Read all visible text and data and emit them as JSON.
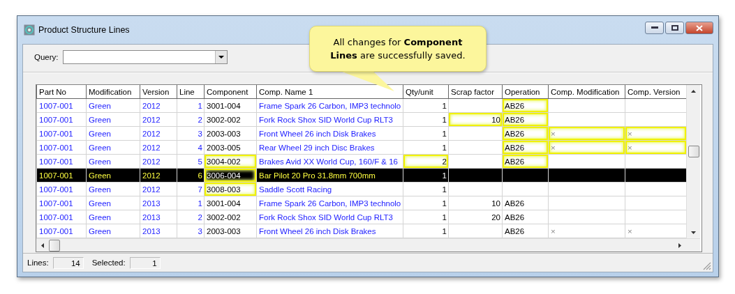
{
  "window": {
    "title": "Product Structure Lines"
  },
  "query": {
    "label": "Query:"
  },
  "callout": {
    "text": "All changes for **Component Lines** are successfully saved."
  },
  "table": {
    "columns": [
      "Part No",
      "Modification",
      "Version",
      "Line",
      "Component",
      "Comp. Name 1",
      "Qty/unit",
      "Scrap factor",
      "Operation",
      "Comp. Modification",
      "Comp. Version"
    ],
    "rows": [
      {
        "selected": false,
        "cells": [
          "1007-001",
          "Green",
          "2012",
          "1",
          "3001-004",
          "Frame Spark 26 Carbon, IMP3 technolo",
          "1",
          null,
          "AB26",
          null,
          null
        ],
        "highlighted": [
          false,
          false,
          false,
          false,
          false,
          false,
          false,
          false,
          true,
          false,
          false
        ]
      },
      {
        "selected": false,
        "cells": [
          "1007-001",
          "Green",
          "2012",
          "2",
          "3002-002",
          "Fork Rock Shox SID World Cup RLT3",
          "1",
          "10",
          "AB26",
          null,
          null
        ],
        "highlighted": [
          false,
          false,
          false,
          false,
          false,
          false,
          false,
          true,
          true,
          false,
          false
        ]
      },
      {
        "selected": false,
        "cells": [
          "1007-001",
          "Green",
          "2012",
          "3",
          "2003-003",
          "Front Wheel 26 inch Disk Brakes",
          "1",
          null,
          "AB26",
          "×",
          "×"
        ],
        "highlighted": [
          false,
          false,
          false,
          false,
          false,
          false,
          false,
          false,
          true,
          true,
          true
        ]
      },
      {
        "selected": false,
        "cells": [
          "1007-001",
          "Green",
          "2012",
          "4",
          "2003-005",
          "Rear Wheel 29 inch Disc Brakes",
          "1",
          null,
          "AB26",
          "×",
          "×"
        ],
        "highlighted": [
          false,
          false,
          false,
          false,
          false,
          false,
          false,
          false,
          true,
          true,
          true
        ]
      },
      {
        "selected": false,
        "cells": [
          "1007-001",
          "Green",
          "2012",
          "5",
          "3004-002",
          "Brakes Avid XX World Cup, 160/F & 16",
          "2",
          null,
          "AB26",
          null,
          null
        ],
        "highlighted": [
          false,
          false,
          false,
          false,
          true,
          false,
          true,
          false,
          true,
          false,
          false
        ]
      },
      {
        "selected": true,
        "cells": [
          "1007-001",
          "Green",
          "2012",
          "6",
          "3006-004",
          "Bar Pilot 20 Pro 31.8mm 700mm",
          "1",
          null,
          null,
          null,
          null
        ],
        "highlighted": [
          false,
          false,
          false,
          false,
          true,
          false,
          false,
          false,
          false,
          false,
          false
        ]
      },
      {
        "selected": false,
        "cells": [
          "1007-001",
          "Green",
          "2012",
          "7",
          "3008-003",
          "Saddle Scott Racing",
          "1",
          null,
          null,
          null,
          null
        ],
        "highlighted": [
          false,
          false,
          false,
          false,
          true,
          false,
          false,
          false,
          false,
          false,
          false
        ]
      },
      {
        "selected": false,
        "cells": [
          "1007-001",
          "Green",
          "2013",
          "1",
          "3001-004",
          "Frame Spark 26 Carbon, IMP3 technolo",
          "1",
          "10",
          "AB26",
          null,
          null
        ],
        "highlighted": [
          false,
          false,
          false,
          false,
          false,
          false,
          false,
          false,
          false,
          false,
          false
        ]
      },
      {
        "selected": false,
        "cells": [
          "1007-001",
          "Green",
          "2013",
          "2",
          "3002-002",
          "Fork Rock Shox SID World Cup RLT3",
          "1",
          "20",
          "AB26",
          null,
          null
        ],
        "highlighted": [
          false,
          false,
          false,
          false,
          false,
          false,
          false,
          false,
          false,
          false,
          false
        ]
      },
      {
        "selected": false,
        "cells": [
          "1007-001",
          "Green",
          "2013",
          "3",
          "2003-003",
          "Front Wheel 26 inch Disk Brakes",
          "1",
          null,
          "AB26",
          "×",
          "×"
        ],
        "highlighted": [
          false,
          false,
          false,
          false,
          false,
          false,
          false,
          false,
          false,
          false,
          false
        ]
      }
    ]
  },
  "status_bar": [
    {
      "label": "Lines:",
      "value": "14"
    },
    {
      "label": "Selected:",
      "value": "1"
    }
  ]
}
